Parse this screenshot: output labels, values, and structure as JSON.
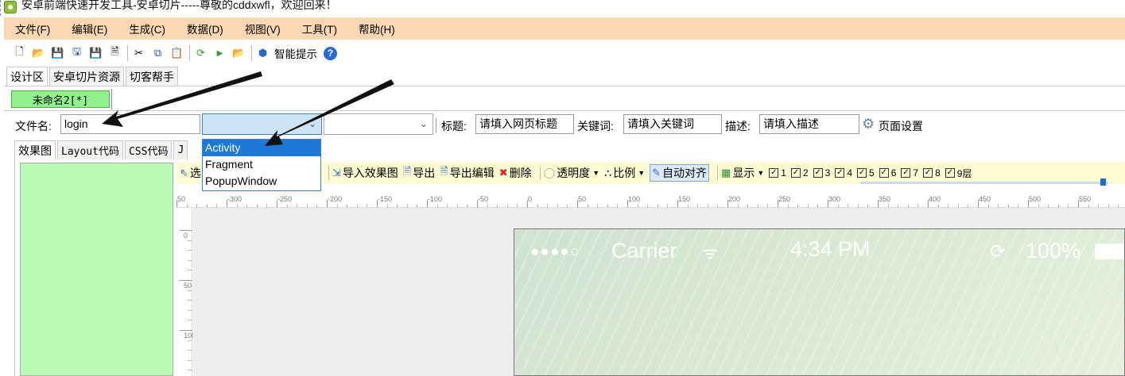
{
  "window": {
    "title": "安卓前端快速开发工具-安卓切片-----尊敬的cddxwfl，欢迎回来！"
  },
  "menu": [
    "文件(F)",
    "编辑(E)",
    "生成(C)",
    "数据(D)",
    "视图(V)",
    "工具(T)",
    "帮助(H)"
  ],
  "toolbar": {
    "smart_hint": "智能提示"
  },
  "top_tabs": [
    "设计区",
    "安卓切片资源",
    "切客帮手"
  ],
  "doc_tab": "未命名2[*]",
  "fields": {
    "filename_label": "文件名:",
    "filename_value": "login",
    "title_label": "标题:",
    "title_value": "请填入网页标题",
    "keywords_label": "关键词:",
    "keywords_value": "请填入关键词",
    "desc_label": "描述:",
    "desc_value": "请填入描述",
    "page_settings": "页面设置"
  },
  "type_dropdown": {
    "options": [
      "Activity",
      "Fragment",
      "PopupWindow"
    ],
    "selected_index": 0
  },
  "lower_tabs": [
    "效果图",
    "Layout代码",
    "CSS代码",
    "J"
  ],
  "design_toolbar": {
    "select_partial": "选",
    "import_effect": "导入效果图",
    "export": "导出",
    "export_edit": "导出编辑",
    "delete": "删除",
    "opacity": "透明度",
    "scale": "比例",
    "auto_align": "自动对齐",
    "display": "显示",
    "checkboxes": [
      "1",
      "2",
      "3",
      "4",
      "5",
      "6",
      "7",
      "8",
      "9层"
    ]
  },
  "ruler": {
    "h_labels": [
      "50",
      "-300",
      "-250",
      "-200",
      "-150",
      "-100",
      "-50",
      "0",
      "50",
      "100",
      "150",
      "200",
      "250",
      "300",
      "350",
      "400",
      "450",
      "500",
      "550",
      "600"
    ],
    "v_labels": [
      "0",
      "50",
      "100"
    ]
  },
  "phone": {
    "signal": "●●●●○",
    "carrier": "Carrier",
    "time": "4:34 PM",
    "battery": "100%"
  }
}
